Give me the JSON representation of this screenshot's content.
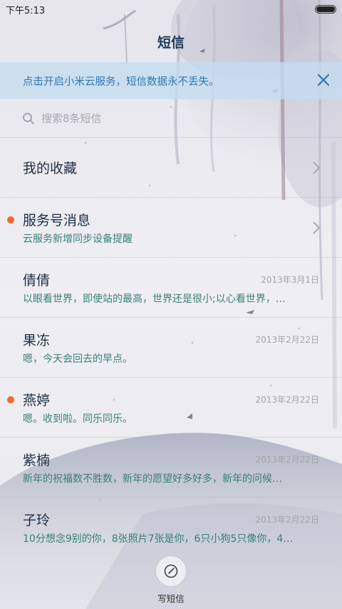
{
  "status_bar": {
    "time": "下午5:13",
    "battery_level": 1.0
  },
  "header": {
    "title": "短信"
  },
  "cloud_banner": {
    "text": "点击开启小米云服务，短信数据永不丢失。",
    "close_icon": "close-icon"
  },
  "search": {
    "placeholder": "搜索8条短信",
    "icon": "search-icon"
  },
  "favorites": {
    "label": "我的收藏"
  },
  "service": {
    "title": "服务号消息",
    "preview": "云服务新增同步设备提醒",
    "unread": true
  },
  "conversations": [
    {
      "name": "倩倩",
      "date": "2013年3月1日",
      "preview": "以眼看世界，即使站的最高，世界还是很小;以心看世界，…",
      "unread": false
    },
    {
      "name": "果冻",
      "date": "2013年2月22日",
      "preview": "嗯，今天会回去的早点。",
      "unread": false
    },
    {
      "name": "燕婷",
      "date": "2013年2月22日",
      "preview": "嗯。收到啦。同乐同乐。",
      "unread": true
    },
    {
      "name": "紫楠",
      "date": "2013年2月22日",
      "preview": "新年的祝福数不胜数，新年的愿望好多好多，新年的问候…",
      "unread": false
    },
    {
      "name": "子玲",
      "date": "2013年2月22日",
      "preview": "10分想念9别的你，8张照片7张是你，6只小狗5只像你，4…",
      "unread": false
    }
  ],
  "compose": {
    "label": "写短信",
    "icon": "compose-icon"
  },
  "colors": {
    "accent": "#2f77b5",
    "unread_dot": "#f16a28",
    "preview_text": "#3a7f78",
    "banner_bg": "#c4dcf0"
  }
}
